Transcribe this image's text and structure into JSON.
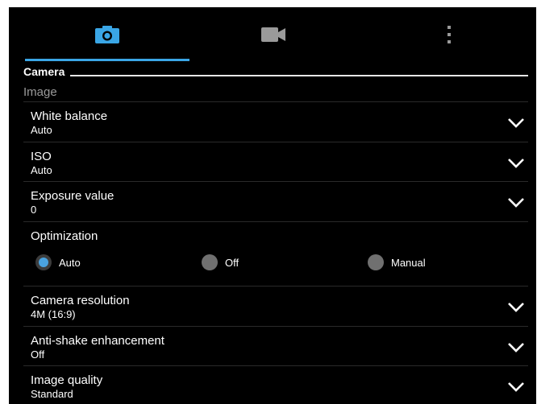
{
  "tabs": [
    {
      "icon": "camera-icon",
      "selected": true
    },
    {
      "icon": "video-camera-icon",
      "selected": false
    },
    {
      "icon": "more-vert-icon",
      "selected": false
    }
  ],
  "accent_color": "#3aa6e6",
  "section": {
    "title": "Camera",
    "category": "Image"
  },
  "settings": [
    {
      "title": "White balance",
      "value": "Auto"
    },
    {
      "title": "ISO",
      "value": "Auto"
    },
    {
      "title": "Exposure value",
      "value": "0"
    }
  ],
  "optimization": {
    "title": "Optimization",
    "options": [
      "Auto",
      "Off",
      "Manual"
    ],
    "selected": "Auto"
  },
  "settings2": [
    {
      "title": "Camera resolution",
      "value": "4M (16:9)"
    },
    {
      "title": "Anti-shake enhancement",
      "value": "Off"
    },
    {
      "title": "Image quality",
      "value": "Standard"
    }
  ]
}
